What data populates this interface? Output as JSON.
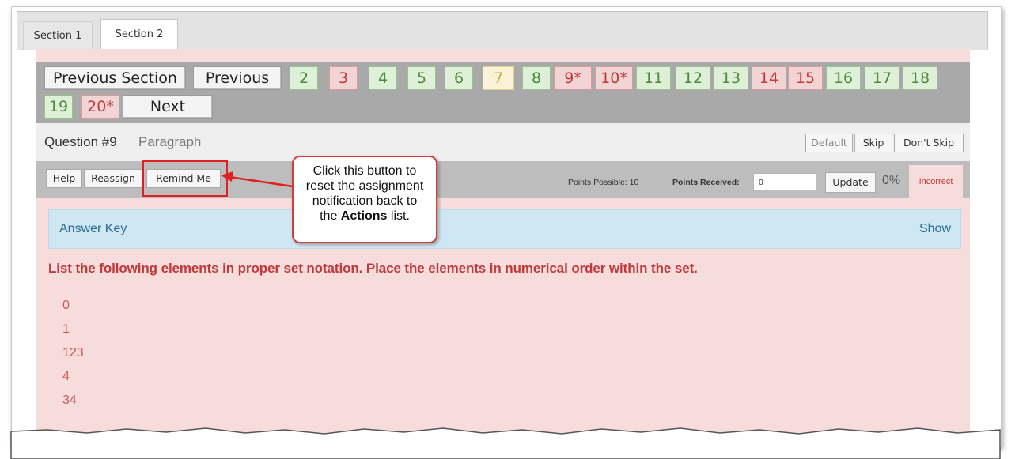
{
  "tabs": [
    {
      "label": "Section 1",
      "active": false
    },
    {
      "label": "Section 2",
      "active": true
    }
  ],
  "nav": {
    "previous_section": "Previous Section",
    "previous": "Previous",
    "next": "Next",
    "questions": [
      {
        "label": "2",
        "status": "green"
      },
      {
        "label": "3",
        "status": "red"
      },
      {
        "label": "4",
        "status": "green"
      },
      {
        "label": "5",
        "status": "green"
      },
      {
        "label": "6",
        "status": "green"
      },
      {
        "label": "7",
        "status": "yellow"
      },
      {
        "label": "8",
        "status": "green"
      },
      {
        "label": "9*",
        "status": "red"
      },
      {
        "label": "10*",
        "status": "red"
      },
      {
        "label": "11",
        "status": "green"
      },
      {
        "label": "12",
        "status": "green"
      },
      {
        "label": "13",
        "status": "green"
      },
      {
        "label": "14",
        "status": "red"
      },
      {
        "label": "15",
        "status": "red"
      },
      {
        "label": "16",
        "status": "green"
      },
      {
        "label": "17",
        "status": "green"
      },
      {
        "label": "18",
        "status": "green"
      },
      {
        "label": "19",
        "status": "green"
      },
      {
        "label": "20*",
        "status": "red"
      }
    ]
  },
  "question": {
    "title": "Question #9",
    "type": "Paragraph",
    "default_label": "Default",
    "skip_label": "Skip",
    "dont_skip_label": "Don't Skip"
  },
  "actions": {
    "help": "Help",
    "reassign": "Reassign",
    "remind_me": "Remind Me",
    "points_possible": "Points Possible: 10",
    "points_received_label": "Points Received:",
    "points_received_value": "0",
    "update": "Update",
    "percent": "0%",
    "status": "Incorrect"
  },
  "answer_key": {
    "label": "Answer Key",
    "show": "Show"
  },
  "prompt": "List the following elements in proper set notation. Place the elements in numerical order within the set.",
  "elements": [
    "0",
    "1",
    "123",
    "4",
    "34"
  ],
  "callout": {
    "line1": "Click this button to",
    "line2": "reset the assignment",
    "line3": "notification back to",
    "line4_pre": "the ",
    "line4_bold": "Actions",
    "line4_post": " list."
  },
  "colors": {
    "green_bg": "#dff0d8",
    "red_bg": "#f2d4d4",
    "yellow_bg": "#fbf3d7",
    "content_bg": "#f7dcdc",
    "accent_red": "#e02020"
  }
}
